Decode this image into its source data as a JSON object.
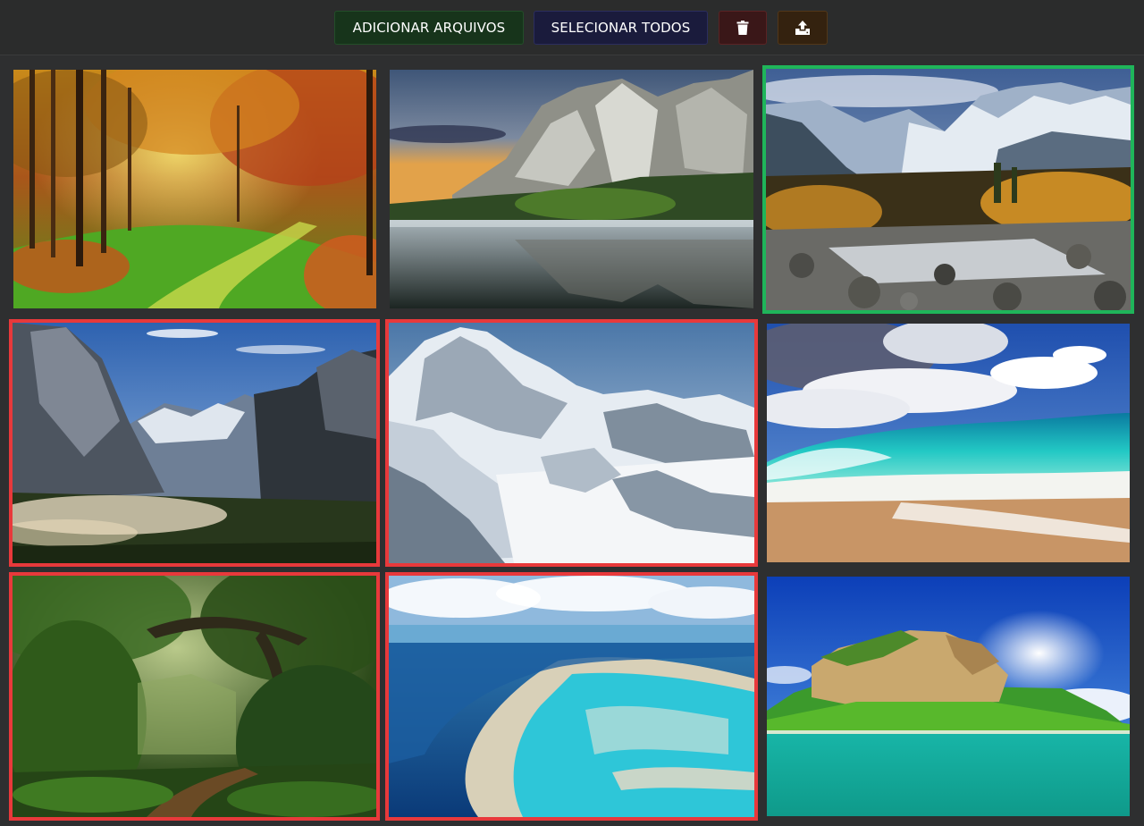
{
  "toolbar": {
    "add_files_label": "ADICIONAR ARQUIVOS",
    "select_all_label": "SELECIONAR TODOS",
    "delete_icon": "trash-icon",
    "upload_icon": "upload-icon",
    "colors": {
      "add": "#17341b",
      "select": "#1a1b3c",
      "delete": "#3a1718",
      "upload": "#34220f"
    }
  },
  "gallery": {
    "selection_colors": {
      "selected": "#e8393b",
      "focused": "#1fb55a"
    },
    "images": [
      {
        "subject": "autumn-forest-path",
        "state": "none"
      },
      {
        "subject": "cliffs-lake-reflection",
        "state": "none"
      },
      {
        "subject": "snowy-mountain-river",
        "state": "focused"
      },
      {
        "subject": "yosemite-valley",
        "state": "selected"
      },
      {
        "subject": "snow-mountain-peak",
        "state": "selected"
      },
      {
        "subject": "ocean-wave-beach",
        "state": "none"
      },
      {
        "subject": "green-jungle",
        "state": "selected"
      },
      {
        "subject": "coral-reef-aerial",
        "state": "selected"
      },
      {
        "subject": "tropical-island",
        "state": "none"
      }
    ]
  }
}
